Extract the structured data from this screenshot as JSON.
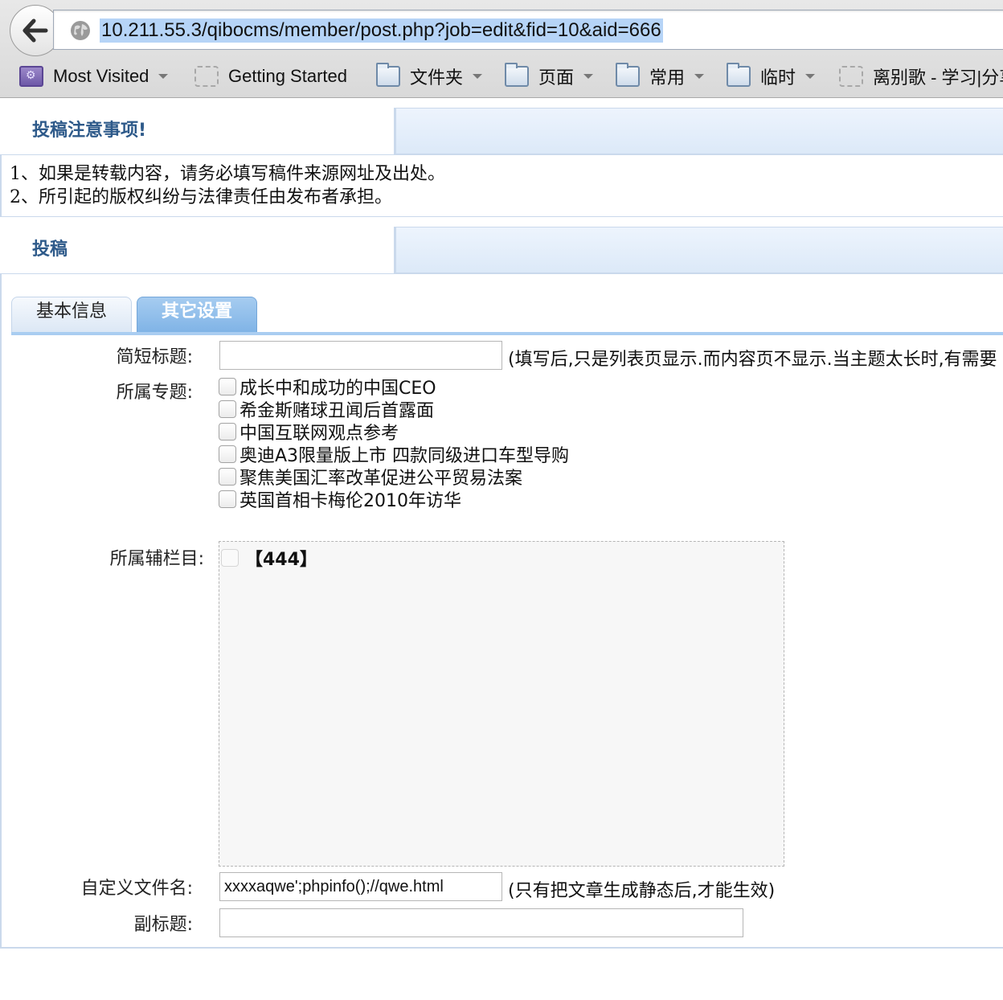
{
  "browser": {
    "url": "10.211.55.3/qibocms/member/post.php?job=edit&fid=10&aid=666",
    "bookmarks": [
      {
        "label": "Most Visited",
        "icon": "most-visited-icon",
        "dropdown": true
      },
      {
        "label": "Getting Started",
        "icon": "page-icon",
        "dropdown": false
      },
      {
        "label": "文件夹",
        "icon": "folder-icon",
        "dropdown": true
      },
      {
        "label": "页面",
        "icon": "folder-icon",
        "dropdown": true
      },
      {
        "label": "常用",
        "icon": "folder-icon",
        "dropdown": true
      },
      {
        "label": "临时",
        "icon": "folder-icon",
        "dropdown": true
      },
      {
        "label": "离别歌 - 学习|分享",
        "icon": "page-icon",
        "dropdown": false
      }
    ]
  },
  "notice": {
    "title": "投稿注意事项!",
    "lines": [
      "1、如果是转载内容，请务必填写稿件来源网址及出处。",
      "2、所引起的版权纠纷与法律责任由发布者承担。"
    ]
  },
  "post": {
    "title": "投稿",
    "tabs": [
      {
        "label": "基本信息",
        "active": false
      },
      {
        "label": "其它设置",
        "active": true
      }
    ],
    "short_title": {
      "label": "简短标题:",
      "value": "",
      "hint": "(填写后,只是列表页显示.而内容页不显示.当主题太长时,有需要"
    },
    "topics": {
      "label": "所属专题:",
      "items": [
        "成长中和成功的中国CEO",
        "希金斯赌球丑闻后首露面",
        "中国互联网观点参考",
        "奥迪A3限量版上市 四款同级进口车型导购",
        "聚焦美国汇率改革促进公平贸易法案",
        "英国首相卡梅伦2010年访华"
      ]
    },
    "sub_column": {
      "label": "所属辅栏目:",
      "items": [
        "【444】"
      ]
    },
    "filename": {
      "label": "自定义文件名:",
      "value": "xxxxaqwe';phpinfo();//qwe.html",
      "hint": "(只有把文章生成静态后,才能生效)"
    },
    "subtitle": {
      "label": "副标题:",
      "value": ""
    }
  },
  "colors": {
    "section_title": "#2e5a8a",
    "active_tab": "#7fb3e6",
    "url_selection": "#b6d4f7",
    "panel_border": "#cad9ec"
  }
}
